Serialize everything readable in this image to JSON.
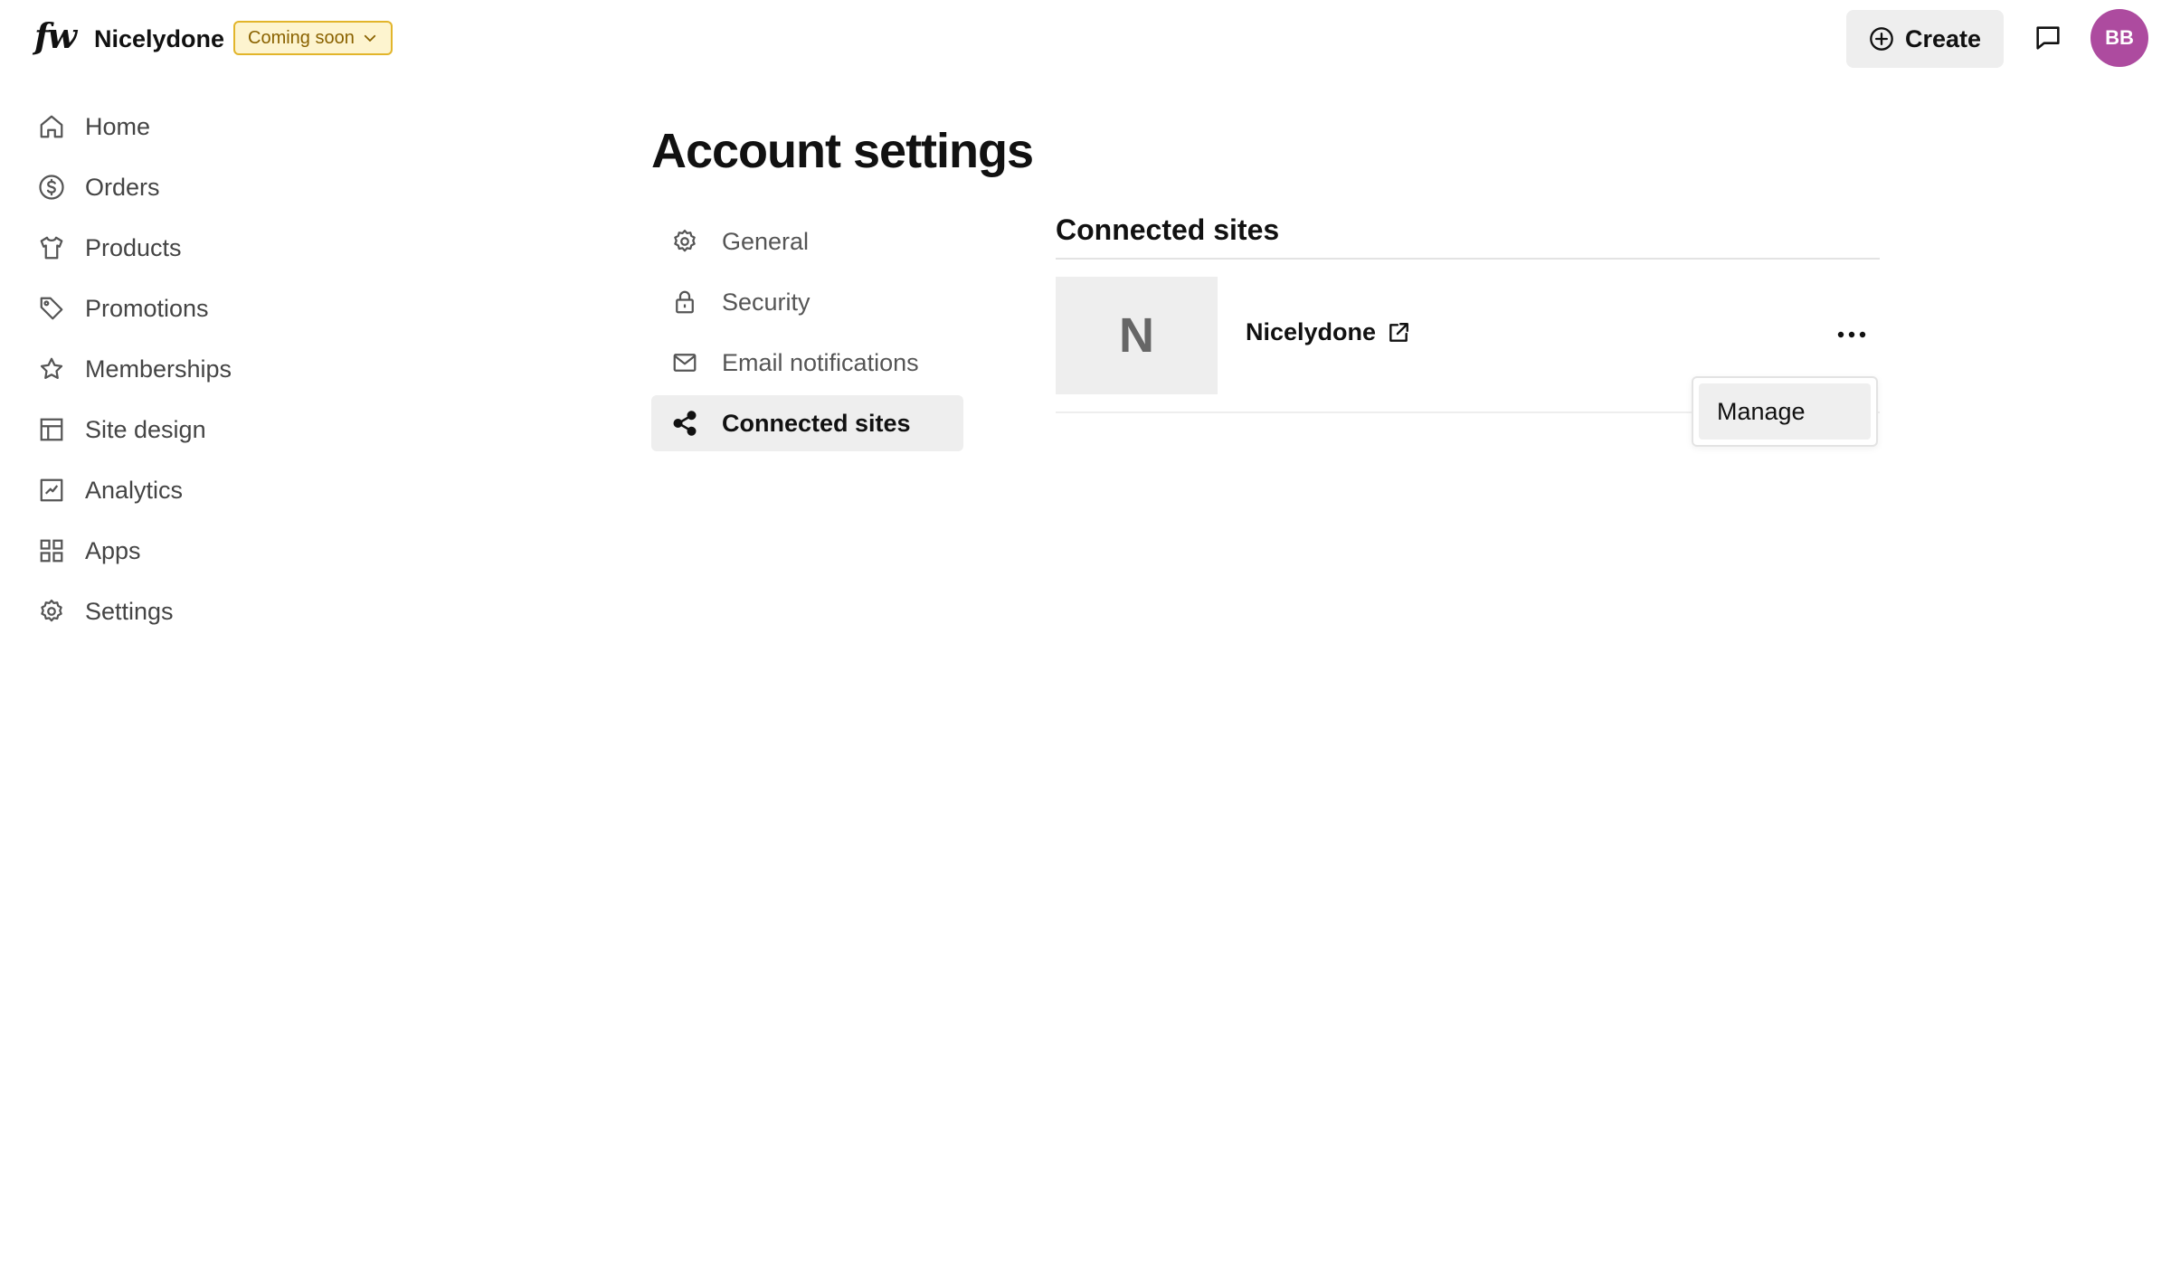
{
  "header": {
    "logo_text": "fw",
    "store_name": "Nicelydone",
    "status_label": "Coming soon",
    "create_label": "Create",
    "avatar_initials": "BB",
    "avatar_color": "#ad4b9f",
    "status_color": "#e2b52b"
  },
  "sidebar": {
    "items": [
      {
        "label": "Home",
        "icon": "home-icon"
      },
      {
        "label": "Orders",
        "icon": "dollar-circle-icon"
      },
      {
        "label": "Products",
        "icon": "shirt-icon"
      },
      {
        "label": "Promotions",
        "icon": "tag-icon"
      },
      {
        "label": "Memberships",
        "icon": "star-icon"
      },
      {
        "label": "Site design",
        "icon": "layout-icon"
      },
      {
        "label": "Analytics",
        "icon": "chart-icon"
      },
      {
        "label": "Apps",
        "icon": "grid-icon"
      },
      {
        "label": "Settings",
        "icon": "gear-icon"
      }
    ]
  },
  "main": {
    "title": "Account settings",
    "settings_nav": [
      {
        "label": "General",
        "icon": "gear-icon",
        "active": false
      },
      {
        "label": "Security",
        "icon": "lock-icon",
        "active": false
      },
      {
        "label": "Email notifications",
        "icon": "mail-icon",
        "active": false
      },
      {
        "label": "Connected sites",
        "icon": "share-icon",
        "active": true
      }
    ],
    "section_title": "Connected sites",
    "site": {
      "initial": "N",
      "name": "Nicelydone"
    },
    "menu": {
      "items": [
        "Manage"
      ]
    }
  }
}
